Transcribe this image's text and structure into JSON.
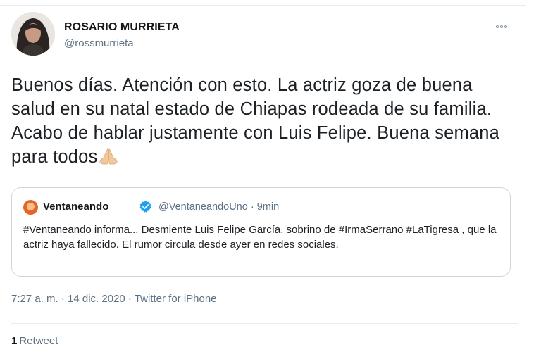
{
  "tweet": {
    "author": {
      "name": "ROSARIO MURRIETA",
      "handle": "@rossmurrieta"
    },
    "text": "Buenos días. Atención con esto. La actriz goza de buena salud en su natal estado de Chiapas rodeada de su familia. Acabo de hablar justamente con Luis Felipe. Buena semana para todos",
    "emoji": "folded-hands-emoji",
    "quoted": {
      "name": "Ventaneando",
      "handle": "@VentaneandoUno",
      "time_ago": "9min",
      "text": "#Ventaneando informa... Desmiente Luis Felipe García, sobrino de #IrmaSerrano #LaTigresa , que la actriz haya fallecido. El rumor circula desde ayer en redes sociales."
    },
    "timestamp": "7:27 a. m. · 14 dic. 2020 · Twitter for iPhone",
    "retweets": {
      "count": "1",
      "label": "Retweet"
    }
  },
  "colors": {
    "verified": "#1da1f2",
    "secondary_text": "#5b7083",
    "border": "#ccd6dd"
  }
}
